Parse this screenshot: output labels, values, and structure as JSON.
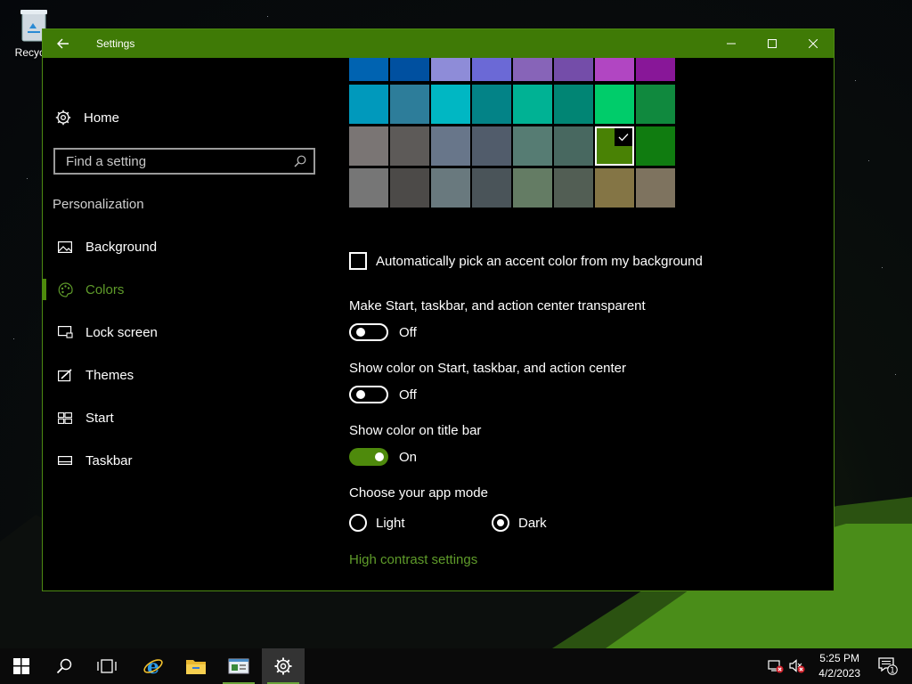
{
  "desktop": {
    "recycle_bin_label": "Recycle"
  },
  "window": {
    "title": "Settings"
  },
  "sidebar": {
    "home_label": "Home",
    "search_placeholder": "Find a setting",
    "section_title": "Personalization",
    "items": [
      {
        "label": "Background",
        "icon": "picture-icon"
      },
      {
        "label": "Colors",
        "icon": "palette-icon",
        "active": true
      },
      {
        "label": "Lock screen",
        "icon": "lock-screen-icon"
      },
      {
        "label": "Themes",
        "icon": "themes-icon"
      },
      {
        "label": "Start",
        "icon": "start-grid-icon"
      },
      {
        "label": "Taskbar",
        "icon": "taskbar-icon"
      }
    ]
  },
  "colors": {
    "swatch_rows": [
      [
        "#0063B1",
        "#0050A0",
        "#8E8CD8",
        "#6B69D6",
        "#8764B8",
        "#744DA9",
        "#B146C2",
        "#881798"
      ],
      [
        "#0099BC",
        "#2D7D9A",
        "#00B7C3",
        "#038387",
        "#00B294",
        "#018574",
        "#00CC6A",
        "#10893E"
      ],
      [
        "#7A7574",
        "#5D5A58",
        "#68768A",
        "#515C6B",
        "#567C73",
        "#486860",
        "#498205",
        "#107C10"
      ],
      [
        "#767676",
        "#4C4A48",
        "#69797E",
        "#4A5459",
        "#647C64",
        "#525E54",
        "#847545",
        "#7E735F"
      ]
    ],
    "selected": "#498205"
  },
  "settings": {
    "auto_accent_label": "Automatically pick an accent color from my background",
    "transparency_label": "Make Start, taskbar, and action center transparent",
    "transparency_state": "Off",
    "show_color_start_label": "Show color on Start, taskbar, and action center",
    "show_color_start_state": "Off",
    "show_color_titlebar_label": "Show color on title bar",
    "show_color_titlebar_state": "On",
    "app_mode_label": "Choose your app mode",
    "app_mode_light": "Light",
    "app_mode_dark": "Dark",
    "app_mode_selected": "Dark",
    "high_contrast_link": "High contrast settings"
  },
  "taskbar": {
    "clock_time": "5:25 PM",
    "clock_date": "4/2/2023",
    "notification_count": "1"
  },
  "accent_color": "#4E8A0C"
}
